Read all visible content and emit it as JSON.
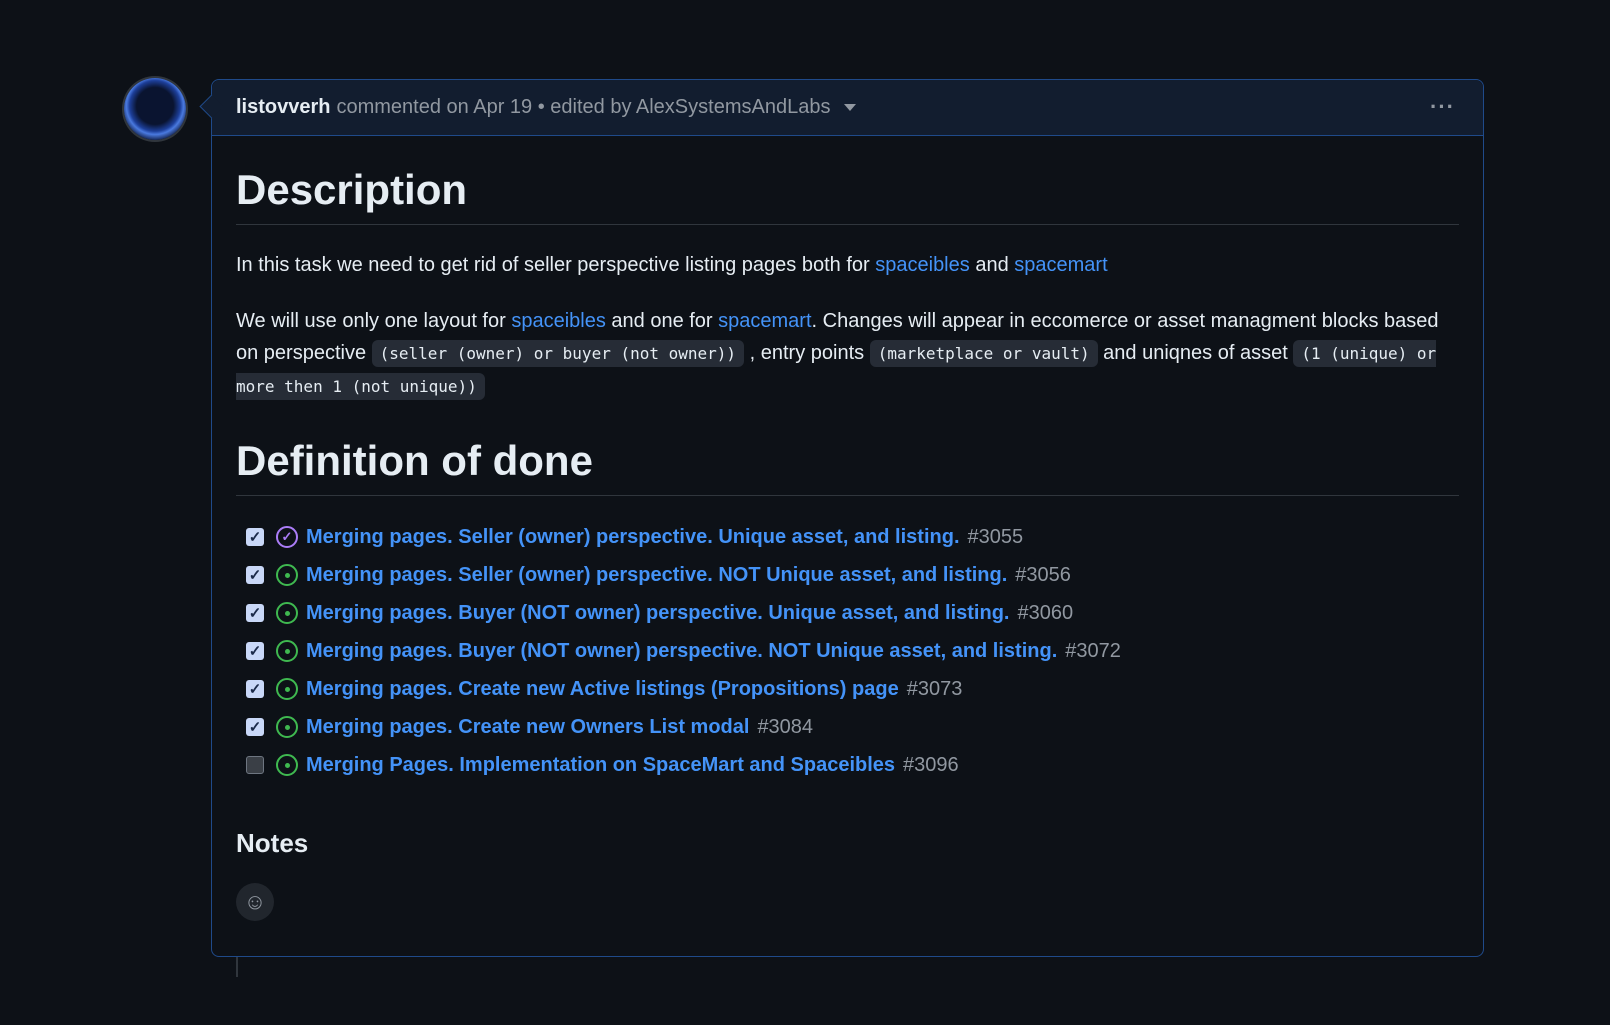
{
  "comment": {
    "author": "listovverh",
    "meta": "commented on Apr 19 • edited by AlexSystemsAndLabs",
    "more_label": "···"
  },
  "content": {
    "heading_description": "Description",
    "para1": {
      "text1": "In this task we need to get rid of seller perspective listing pages both for ",
      "link1": "spaceibles",
      "text2": " and ",
      "link2": "spacemart"
    },
    "para2": {
      "text1": "We will use only one layout for ",
      "link1": "spaceibles",
      "text2": " and one for ",
      "link2": "spacemart",
      "text3": ". Changes will appear in eccomerce or asset managment blocks based on perspective ",
      "code1": "(seller (owner) or buyer (not owner))",
      "text4": " , entry points ",
      "code2": "(marketplace or vault)",
      "text5": " and uniqnes of asset ",
      "code3": "(1 (unique) or more then 1 (not unique))"
    },
    "heading_dod": "Definition of done",
    "tasks": [
      {
        "title": "Merging pages. Seller (owner) perspective. Unique asset, and listing.",
        "number": "#3055",
        "checked": true,
        "status": "closed"
      },
      {
        "title": "Merging pages. Seller (owner) perspective. NOT Unique asset, and listing.",
        "number": "#3056",
        "checked": true,
        "status": "open"
      },
      {
        "title": "Merging pages. Buyer (NOT owner) perspective. Unique asset, and listing.",
        "number": "#3060",
        "checked": true,
        "status": "open"
      },
      {
        "title": "Merging pages. Buyer (NOT owner) perspective. NOT Unique asset, and listing.",
        "number": "#3072",
        "checked": true,
        "status": "open"
      },
      {
        "title": "Merging pages. Create new Active listings (Propositions) page",
        "number": "#3073",
        "checked": true,
        "status": "open"
      },
      {
        "title": "Merging pages. Create new Owners List modal",
        "number": "#3084",
        "checked": true,
        "status": "open"
      },
      {
        "title": "Merging Pages. Implementation on SpaceMart and Spaceibles",
        "number": "#3096",
        "checked": false,
        "status": "open"
      }
    ],
    "heading_notes": "Notes"
  },
  "icons": {
    "avatar": "avatar-image",
    "caret": "chevron-down-icon",
    "more": "kebab-horizontal-icon",
    "emoji": "smiley-icon"
  },
  "colors": {
    "background": "#0d1117",
    "link": "#4493f8",
    "open_status": "#3fb950",
    "closed_status": "#ab7df8",
    "border_accent": "#1f4a8a"
  }
}
